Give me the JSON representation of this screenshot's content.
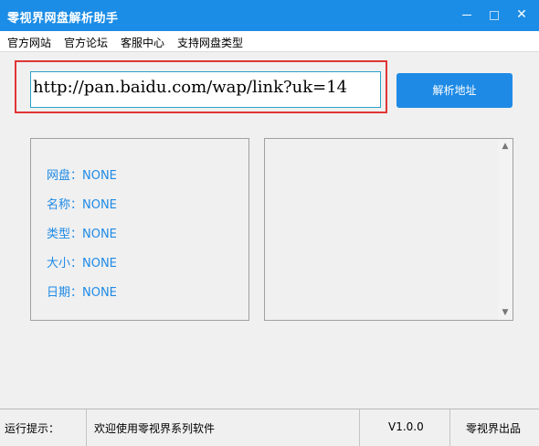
{
  "window": {
    "title": "零视界网盘解析助手"
  },
  "menu": {
    "items": [
      "官方网站",
      "官方论坛",
      "客服中心",
      "支持网盘类型"
    ]
  },
  "url": {
    "value": "http://pan.baidu.com/wap/link?uk=14"
  },
  "parse_button": {
    "label": "解析地址"
  },
  "info": {
    "rows": [
      {
        "label": "网盘：NONE"
      },
      {
        "label": "名称：NONE"
      },
      {
        "label": "类型：NONE"
      },
      {
        "label": "大小：NONE"
      },
      {
        "label": "日期：NONE"
      }
    ]
  },
  "status": {
    "label": "运行提示：",
    "message": "欢迎使用零视界系列软件",
    "version": "V1.0.0",
    "publisher": "零视界出品"
  },
  "colors": {
    "accent": "#1e8ae6",
    "titlebar": "#1c8de6",
    "highlight": "#e03535"
  }
}
